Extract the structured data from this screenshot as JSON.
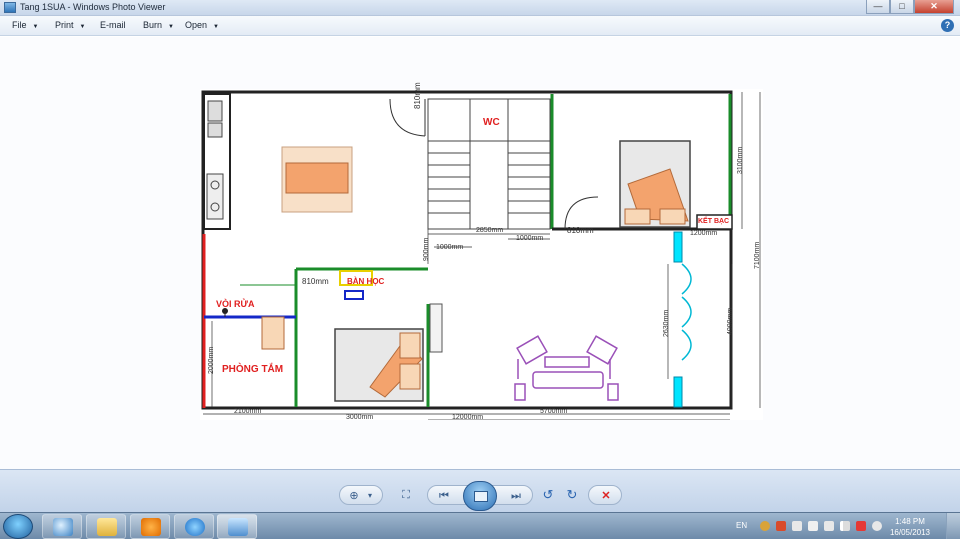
{
  "window": {
    "title": "Tang 1SUA - Windows Photo Viewer",
    "minimize": "—",
    "maximize": "□",
    "close": "✕"
  },
  "menu": {
    "items": [
      {
        "label": "File",
        "has_arrow": true
      },
      {
        "label": "Print",
        "has_arrow": true
      },
      {
        "label": "E-mail",
        "has_arrow": false
      },
      {
        "label": "Burn",
        "has_arrow": true
      },
      {
        "label": "Open",
        "has_arrow": true
      }
    ],
    "help": "?"
  },
  "plan": {
    "labels": {
      "wc": "WC",
      "ket_bac": "KẾT BẠC",
      "ban_hoc": "BÀN HỌC",
      "voi_rua": "VÒI RỬA",
      "phong_tam": "PHÒNG TẮM"
    },
    "dimensions": {
      "d810_top": "810mm",
      "d2850": "2850mm",
      "d1000_a": "1000mm",
      "d1000_b": "1000mm",
      "d810_mid": "810mm",
      "d3100": "3100mm",
      "d1200": "1200mm",
      "d7100": "7100mm",
      "d900": "900mm",
      "d810_left": "810mm",
      "d2630": "2630mm",
      "d4000": "4000mm",
      "d2000": "2000mm",
      "d2100": "2100mm",
      "d3000": "3000mm",
      "d5700": "5700mm",
      "d12000": "12000mm"
    }
  },
  "toolbar": {
    "zoom": "⊕",
    "zoom_arrow": "▾",
    "fit": "⛶",
    "prev": "⏮",
    "next": "⏭",
    "rotate_ccw": "↺",
    "rotate_cw": "↻",
    "delete": "✕"
  },
  "taskbar": {
    "language": "EN",
    "time": "1:48 PM",
    "date": "16/05/2013"
  }
}
